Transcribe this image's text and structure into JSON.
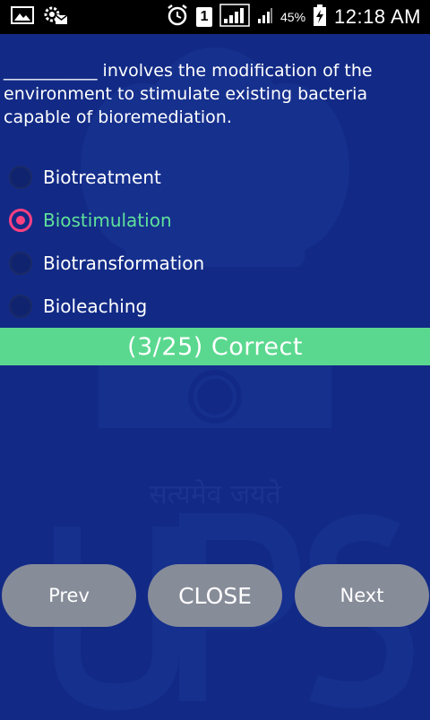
{
  "status_bar": {
    "battery_percent": "45%",
    "time": "12:18 AM",
    "sim_slot": "1",
    "icons": [
      "image-icon",
      "settings-mail-icon",
      "alarm-icon",
      "sim-icon",
      "signal-icon",
      "signal-icon",
      "battery-charging-icon"
    ]
  },
  "quiz": {
    "question": "___________ involves the modification of the environment to stimulate existing bacteria capable of bioremediation.",
    "options": [
      {
        "label": "Biotreatment",
        "selected": false
      },
      {
        "label": "Biostimulation",
        "selected": true
      },
      {
        "label": "Biotransformation",
        "selected": false
      },
      {
        "label": "Bioleaching",
        "selected": false
      }
    ],
    "result": "(3/25)  Correct"
  },
  "watermark": {
    "motto": "सत्यमेव जयते",
    "text": "UPSC"
  },
  "nav": {
    "prev_label": "Prev",
    "close_label": "CLOSE",
    "next_label": "Next"
  },
  "colors": {
    "background": "#122a86",
    "accent_pink": "#ff4081",
    "correct_green": "#5bd88f",
    "selected_text": "#5fe09a",
    "button_gray": "#878c99"
  }
}
